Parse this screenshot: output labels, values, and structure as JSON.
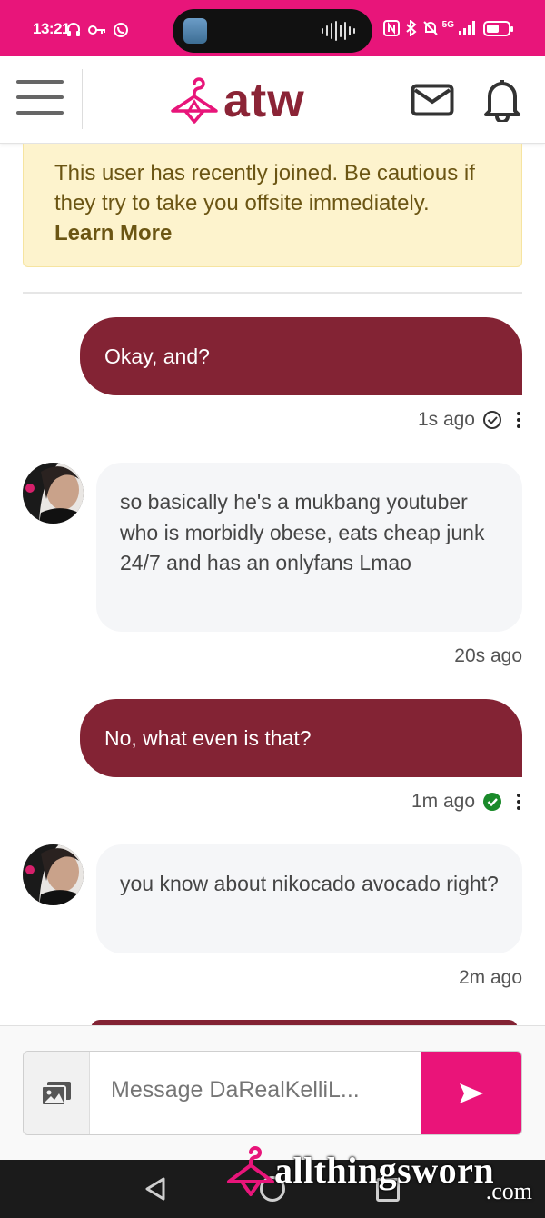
{
  "status_bar": {
    "time": "13:21",
    "network": "5G",
    "battery_level": 0.6
  },
  "header": {
    "logo_text": "atw",
    "menu_icon": "hamburger-menu-icon",
    "mail_icon": "envelope-icon",
    "bell_icon": "bell-icon"
  },
  "warning": {
    "text": "This user has recently joined. Be cautious if they try to take you offsite immediately.",
    "link": "Learn More"
  },
  "messages": [
    {
      "direction": "out",
      "text": "Okay, and?",
      "time": "1s ago",
      "status": "sent"
    },
    {
      "direction": "in",
      "text": "so basically he's a mukbang youtuber who is morbidly obese, eats cheap junk 24/7 and has an onlyfans Lmao",
      "time": "20s ago"
    },
    {
      "direction": "out",
      "text": "No, what even is that?",
      "time": "1m ago",
      "status": "read"
    },
    {
      "direction": "in",
      "text": "you know about nikocado avocado right?",
      "time": "2m ago"
    }
  ],
  "composer": {
    "placeholder": "Message DaRealKelliL..."
  },
  "watermark": {
    "text": "allthingsworn",
    "suffix": ".com"
  },
  "colors": {
    "brand_pink": "#e8157a",
    "bubble_maroon": "#832334",
    "read_green": "#1a8a2a"
  }
}
